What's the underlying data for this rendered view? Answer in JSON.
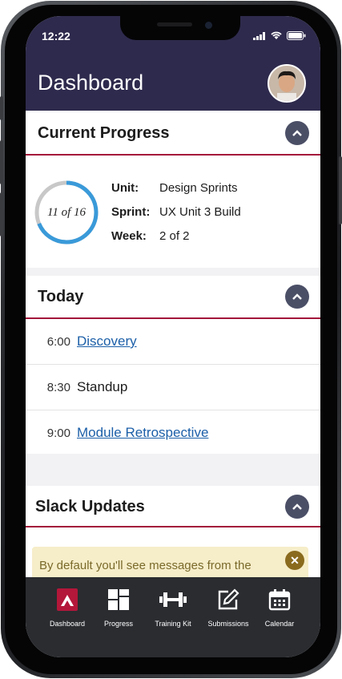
{
  "status": {
    "time": "12:22"
  },
  "header": {
    "title": "Dashboard"
  },
  "progress": {
    "heading": "Current Progress",
    "ring_label": "11 of 16",
    "ring_fraction": 0.6875,
    "rows": [
      {
        "key": "Unit:",
        "value": "Design Sprints"
      },
      {
        "key": "Sprint:",
        "value": "UX Unit 3 Build"
      },
      {
        "key": "Week:",
        "value": "2 of 2"
      }
    ]
  },
  "today": {
    "heading": "Today",
    "events": [
      {
        "time": "6:00",
        "name": "Discovery",
        "link": true
      },
      {
        "time": "8:30",
        "name": "Standup",
        "link": false
      },
      {
        "time": "9:00",
        "name": "Module Retrospective",
        "link": true
      }
    ]
  },
  "slack": {
    "heading": "Slack Updates",
    "alert_text": "By default you'll see messages from the"
  },
  "tabs": [
    {
      "label": "Dashboard",
      "icon": "logo-icon",
      "active": true
    },
    {
      "label": "Progress",
      "icon": "grid-icon"
    },
    {
      "label": "Training Kit",
      "icon": "dumbbell-icon"
    },
    {
      "label": "Submissions",
      "icon": "edit-icon"
    },
    {
      "label": "Calendar",
      "icon": "calendar-icon"
    }
  ],
  "colors": {
    "header": "#2e2a4d",
    "accent": "#a3173a",
    "link": "#1c5fa8",
    "ring_fill": "#3a9ad9"
  }
}
